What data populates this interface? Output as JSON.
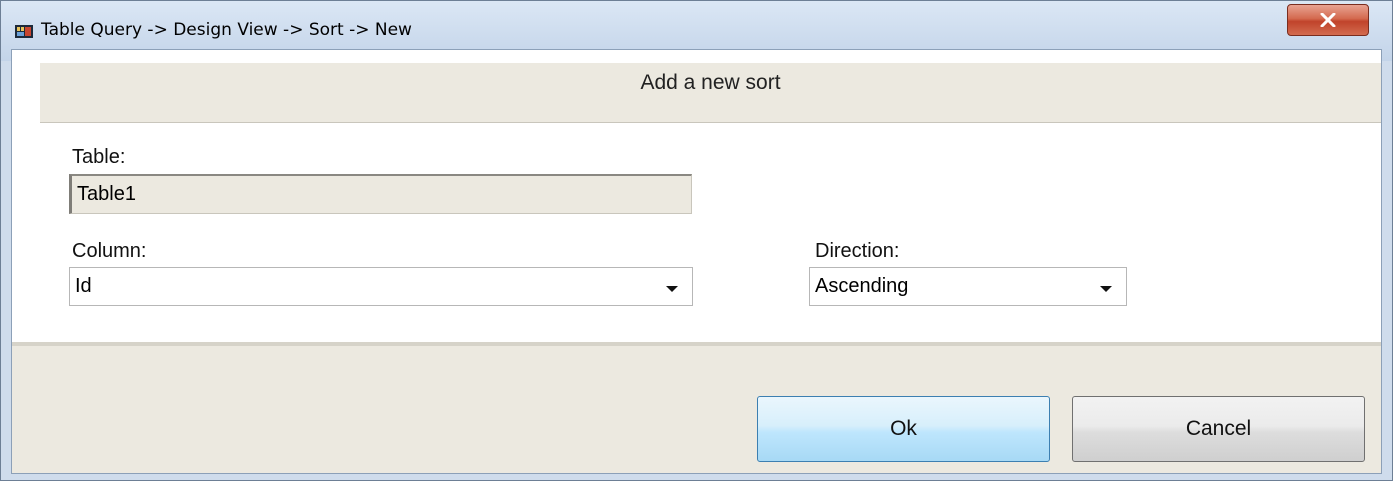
{
  "window": {
    "title": "Table Query -> Design View -> Sort -> New",
    "close_symbol": "x"
  },
  "header": {
    "text": "Add a new sort"
  },
  "form": {
    "table_label": "Table:",
    "table_value": "Table1",
    "column_label": "Column:",
    "column_value": "Id",
    "direction_label": "Direction:",
    "direction_value": "Ascending"
  },
  "buttons": {
    "ok_label": "Ok",
    "cancel_label": "Cancel"
  },
  "colors": {
    "close_button": "#c94a2f",
    "ok_button": "#bee6fd",
    "panel": "#ece9e0"
  }
}
